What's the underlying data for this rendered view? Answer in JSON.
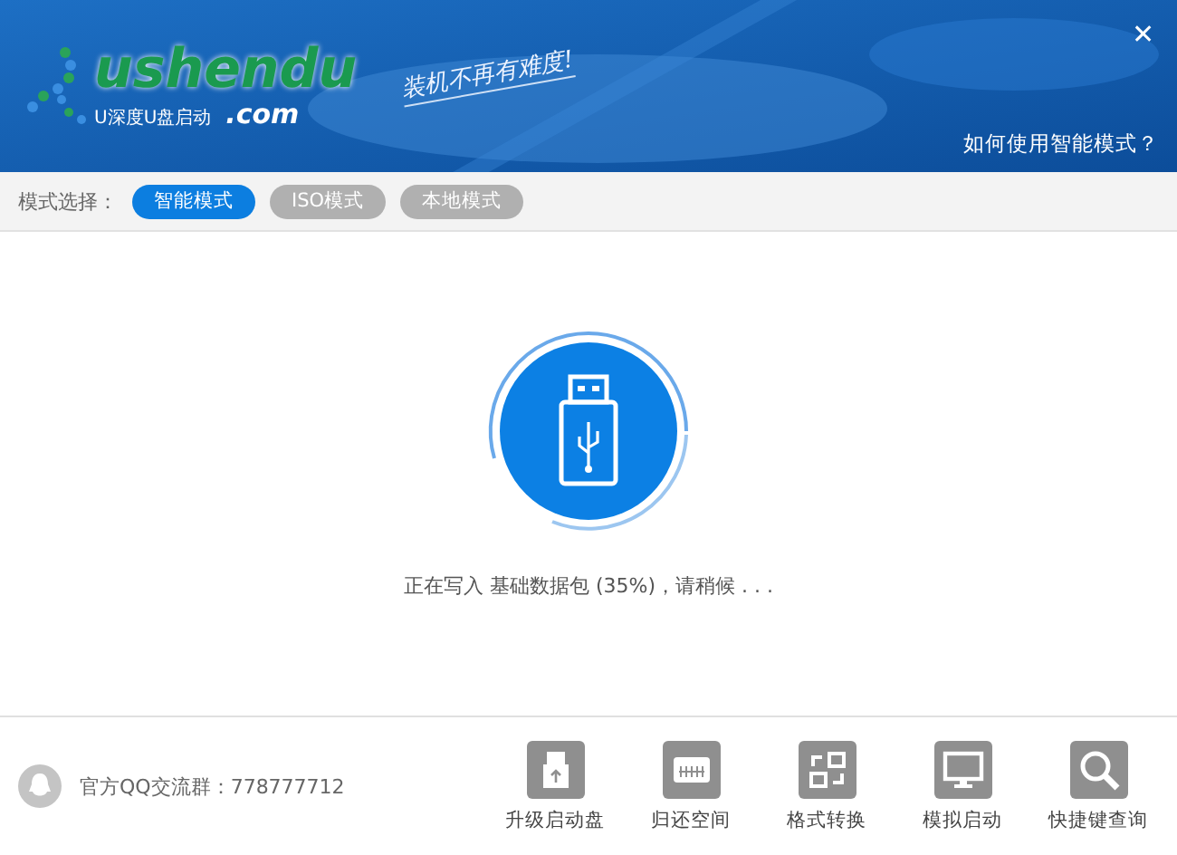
{
  "header": {
    "logo": {
      "wordmark": "ushendu",
      "domain": ".com",
      "subtitle": "U深度U盘启动"
    },
    "slogan": "装机不再有难度!",
    "close": "✕",
    "help_link": "如何使用智能模式？"
  },
  "mode_bar": {
    "label": "模式选择：",
    "modes": [
      {
        "label": "智能模式",
        "selected": true
      },
      {
        "label": "ISO模式",
        "selected": false
      },
      {
        "label": "本地模式",
        "selected": false
      }
    ]
  },
  "progress": {
    "status": "正在写入 基础数据包 (35%)，请稍候 . . ."
  },
  "footer": {
    "qq_group": "官方QQ交流群：778777712",
    "tools": [
      {
        "kind": "upgrade",
        "label": "升级启动盘"
      },
      {
        "kind": "restore",
        "label": "归还空间"
      },
      {
        "kind": "convert",
        "label": "格式转换"
      },
      {
        "kind": "simulate",
        "label": "模拟启动"
      },
      {
        "kind": "shortcut",
        "label": "快捷键查询"
      }
    ]
  }
}
